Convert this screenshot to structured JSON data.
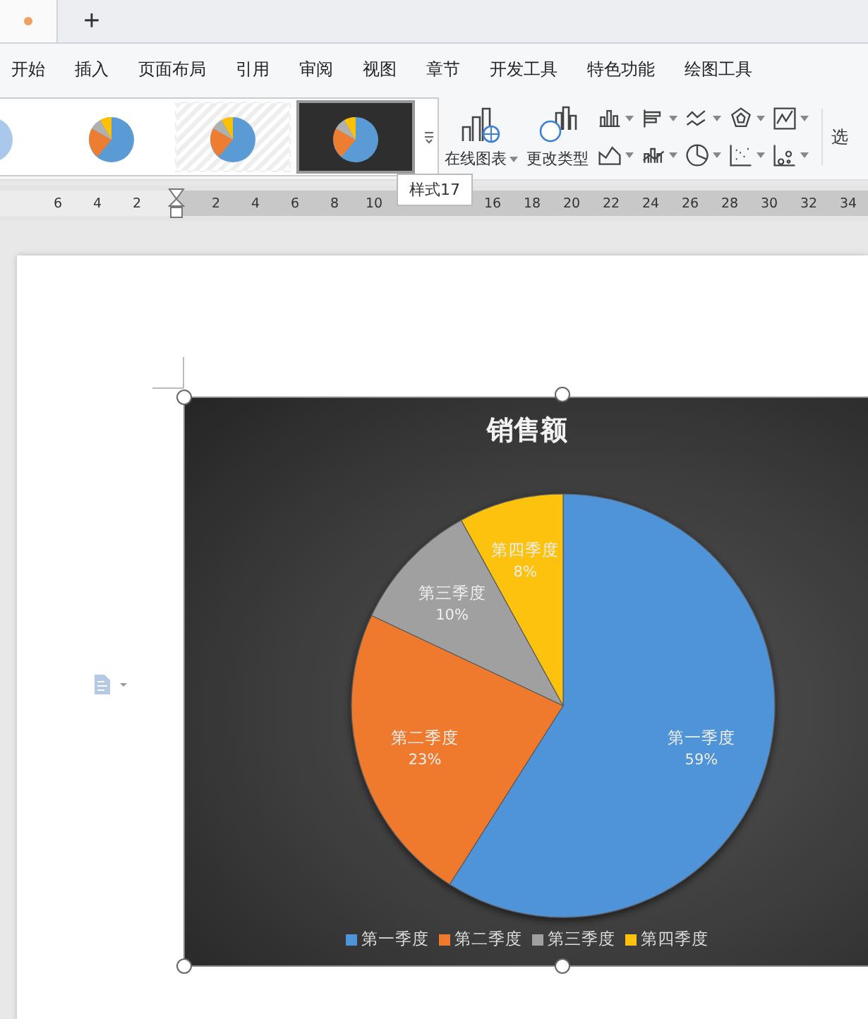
{
  "tabs": [
    {
      "kind": "doc",
      "selected": true
    },
    {
      "kind": "new",
      "label": "+",
      "selected": false
    }
  ],
  "menu": [
    {
      "label": "开始"
    },
    {
      "label": "插入"
    },
    {
      "label": "页面布局"
    },
    {
      "label": "引用"
    },
    {
      "label": "审阅"
    },
    {
      "label": "视图"
    },
    {
      "label": "章节"
    },
    {
      "label": "开发工具"
    },
    {
      "label": "特色功能"
    },
    {
      "label": "绘图工具"
    }
  ],
  "ribbon": {
    "styles": [
      {
        "kind": "plain",
        "selected": false
      },
      {
        "kind": "white",
        "selected": false
      },
      {
        "kind": "hatched",
        "selected": false
      },
      {
        "kind": "dark",
        "selected": true
      }
    ],
    "buttons": [
      {
        "label": "在线图表"
      },
      {
        "label": "更改类型"
      }
    ],
    "chart_types": [
      {
        "kind": "column"
      },
      {
        "kind": "bar"
      },
      {
        "kind": "line"
      },
      {
        "kind": "radar"
      },
      {
        "kind": "stock"
      },
      {
        "kind": "area"
      },
      {
        "kind": "combo"
      },
      {
        "kind": "pie"
      },
      {
        "kind": "scatter"
      },
      {
        "kind": "bubble"
      }
    ],
    "cut_button": "选"
  },
  "ruler": {
    "left_ticks": [
      "6",
      "4",
      "2"
    ],
    "right_ticks": [
      "2",
      "4",
      "6",
      "8",
      "10"
    ],
    "right_ticks_after": [
      "16",
      "18",
      "20",
      "22",
      "24",
      "26",
      "28",
      "30",
      "32",
      "34"
    ]
  },
  "tooltip": "样式17",
  "chart": {
    "chart_data": {
      "type": "pie",
      "title": "销售额",
      "categories": [
        "第一季度",
        "第二季度",
        "第三季度",
        "第四季度"
      ],
      "series": [
        {
          "colors": [
            "#4f93d8",
            "#ef7a2e",
            "#a0a0a0",
            "#fcc20e"
          ],
          "values": [
            59,
            23,
            10,
            8
          ]
        }
      ],
      "value_labels": [
        "59%",
        "23%",
        "10%",
        "8%"
      ],
      "legend": true
    }
  }
}
